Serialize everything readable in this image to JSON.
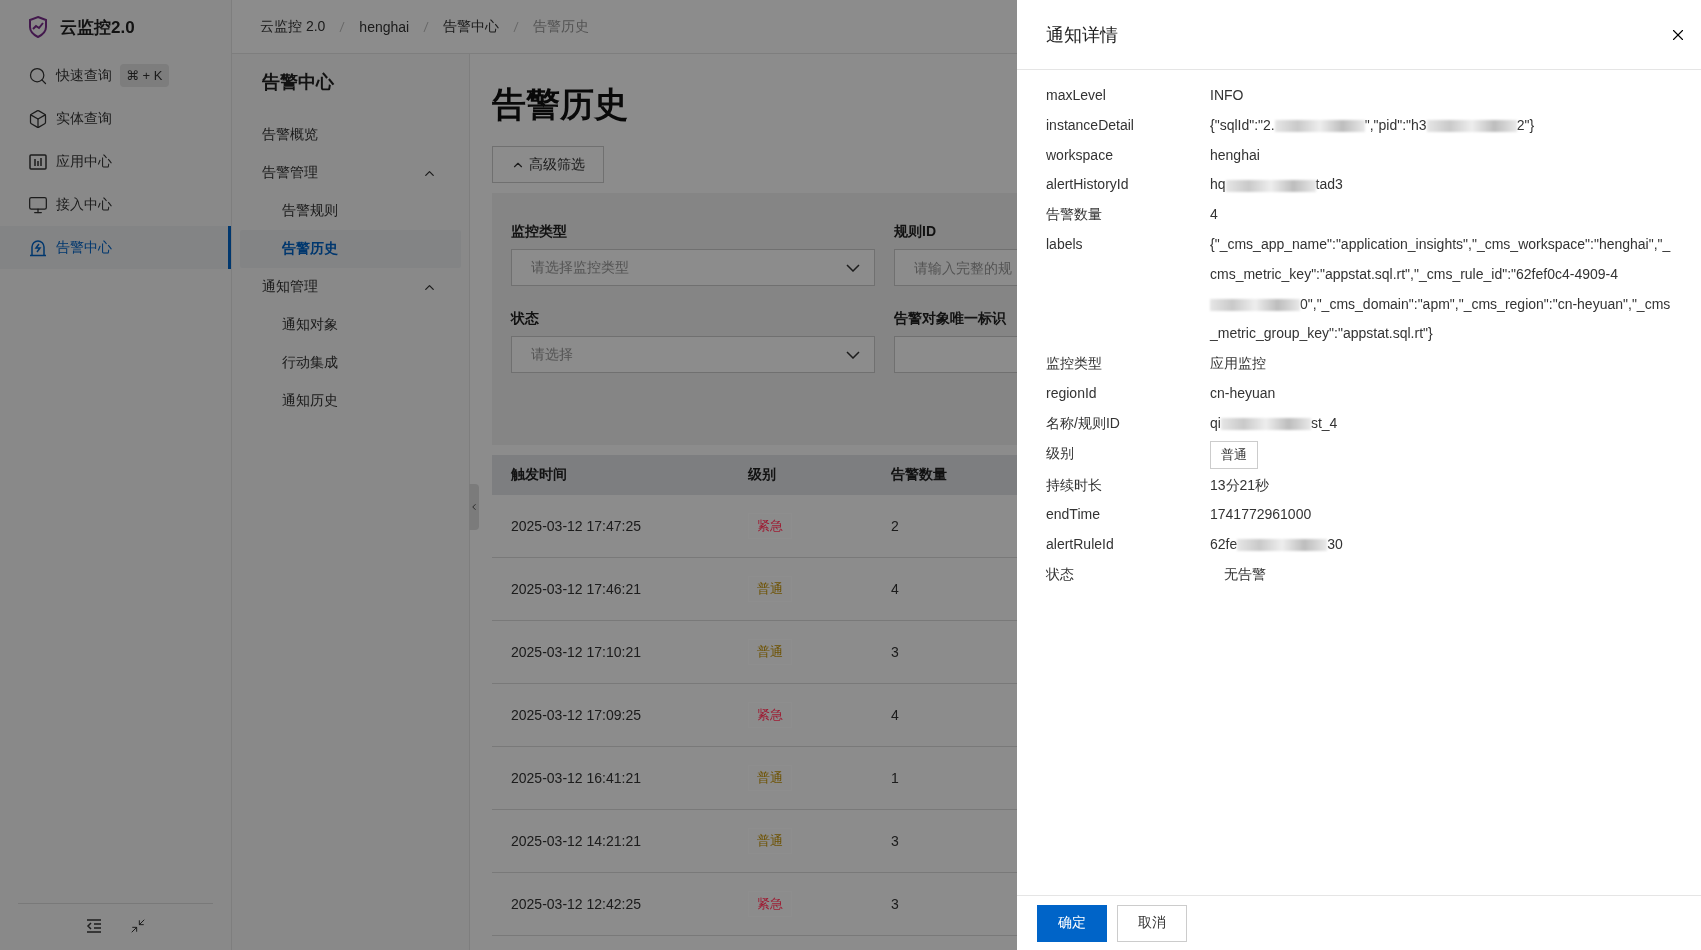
{
  "app": {
    "name": "云监控2.0",
    "nav": [
      {
        "label": "快速查询",
        "shortcut": "⌘ + K",
        "selected": false
      },
      {
        "label": "实体查询",
        "selected": false
      },
      {
        "label": "应用中心",
        "selected": false
      },
      {
        "label": "接入中心",
        "selected": false
      },
      {
        "label": "告警中心",
        "selected": true
      }
    ]
  },
  "breadcrumb": [
    "云监控 2.0",
    "henghai",
    "告警中心",
    "告警历史"
  ],
  "subnav": {
    "title": "告警中心",
    "items": [
      {
        "label": "告警概览",
        "selected": false
      },
      {
        "label": "告警管理",
        "expanded": true,
        "selected": false,
        "children": [
          {
            "label": "告警规则",
            "selected": false
          },
          {
            "label": "告警历史",
            "selected": true
          }
        ]
      },
      {
        "label": "通知管理",
        "expanded": true,
        "selected": false,
        "children": [
          {
            "label": "通知对象",
            "selected": false
          },
          {
            "label": "行动集成",
            "selected": false
          },
          {
            "label": "通知历史",
            "selected": false
          }
        ]
      }
    ]
  },
  "page": {
    "title": "告警历史",
    "filter_toggle": "高级筛选",
    "filters": [
      {
        "label": "监控类型",
        "kind": "select",
        "placeholder": "请选择监控类型"
      },
      {
        "label": "规则ID",
        "kind": "input",
        "placeholder": "请输入完整的规"
      },
      {
        "label": "状态",
        "kind": "select",
        "placeholder": "请选择"
      },
      {
        "label": "告警对象唯一标识",
        "kind": "input"
      }
    ],
    "table": {
      "columns": [
        "触发时间",
        "级别",
        "告警数量"
      ],
      "rows": [
        {
          "time": "2025-03-12 17:47:25",
          "level": "紧急",
          "color": "#9e1b32",
          "count": "2"
        },
        {
          "time": "2025-03-12 17:46:21",
          "level": "普通",
          "color": "#6e5200",
          "count": "4"
        },
        {
          "time": "2025-03-12 17:10:21",
          "level": "普通",
          "color": "#6e5200",
          "count": "3"
        },
        {
          "time": "2025-03-12 17:09:25",
          "level": "紧急",
          "color": "#9e1b32",
          "count": "4"
        },
        {
          "time": "2025-03-12 16:41:21",
          "level": "普通",
          "color": "#6e5200",
          "count": "1"
        },
        {
          "time": "2025-03-12 14:21:21",
          "level": "普通",
          "color": "#6e5200",
          "count": "3"
        },
        {
          "time": "2025-03-12 12:42:25",
          "level": "紧急",
          "color": "#9e1b32",
          "count": "3"
        }
      ]
    }
  },
  "drawer": {
    "title": "通知详情",
    "fields": [
      {
        "label": "maxLevel",
        "kind": "text",
        "value": "INFO"
      },
      {
        "label": "instanceDetail",
        "kind": "redacted",
        "segments": [
          {
            "kind": "text",
            "text": "{\"sqlId\":\"2."
          },
          {
            "kind": "redacted"
          },
          {
            "kind": "text",
            "text": "\",\"pid\":\"h3"
          },
          {
            "kind": "redacted"
          },
          {
            "kind": "text",
            "text": "2\"}"
          }
        ]
      },
      {
        "label": "workspace",
        "kind": "text",
        "value": "henghai"
      },
      {
        "label": "alertHistoryId",
        "kind": "redacted",
        "segments": [
          {
            "kind": "text",
            "text": "hq"
          },
          {
            "kind": "redacted"
          },
          {
            "kind": "text",
            "text": "tad3"
          }
        ]
      },
      {
        "label": "告警数量",
        "kind": "text",
        "value": "4"
      },
      {
        "label": "labels",
        "kind": "redacted",
        "segments": [
          {
            "kind": "text",
            "text": "{\"_cms_app_name\":\"application_insights\",\"_cms_workspace\":\"henghai\",\"_cms_metric_key\":\"appstat.sql.rt\",\"_cms_rule_id\":\"62fef0c4-4909-4"
          },
          {
            "kind": "redacted"
          },
          {
            "kind": "text",
            "text": "0\",\"_cms_domain\":\"apm\",\"_cms_region\":\"cn-heyuan\",\"_cms_metric_group_key\":\"appstat.sql.rt\"}"
          }
        ]
      },
      {
        "label": "监控类型",
        "kind": "text",
        "value": "应用监控"
      },
      {
        "label": "regionId",
        "kind": "text",
        "value": "cn-heyuan"
      },
      {
        "label": "名称/规则ID",
        "kind": "redacted",
        "segments": [
          {
            "kind": "text",
            "text": "qi"
          },
          {
            "kind": "redacted"
          },
          {
            "kind": "text",
            "text": "st_4"
          }
        ]
      },
      {
        "label": "级别",
        "kind": "tag",
        "value": "普通"
      },
      {
        "label": "持续时长",
        "kind": "text",
        "value": "13分21秒"
      },
      {
        "label": "endTime",
        "kind": "text",
        "value": "1741772961000"
      },
      {
        "label": "alertRuleId",
        "kind": "redacted",
        "segments": [
          {
            "kind": "text",
            "text": "62fe"
          },
          {
            "kind": "redacted"
          },
          {
            "kind": "text",
            "text": "30"
          }
        ]
      },
      {
        "label": "状态",
        "kind": "status",
        "value": "无告警"
      }
    ],
    "buttons": [
      {
        "label": "确定",
        "primary": true
      },
      {
        "label": "取消",
        "primary": false
      }
    ]
  }
}
